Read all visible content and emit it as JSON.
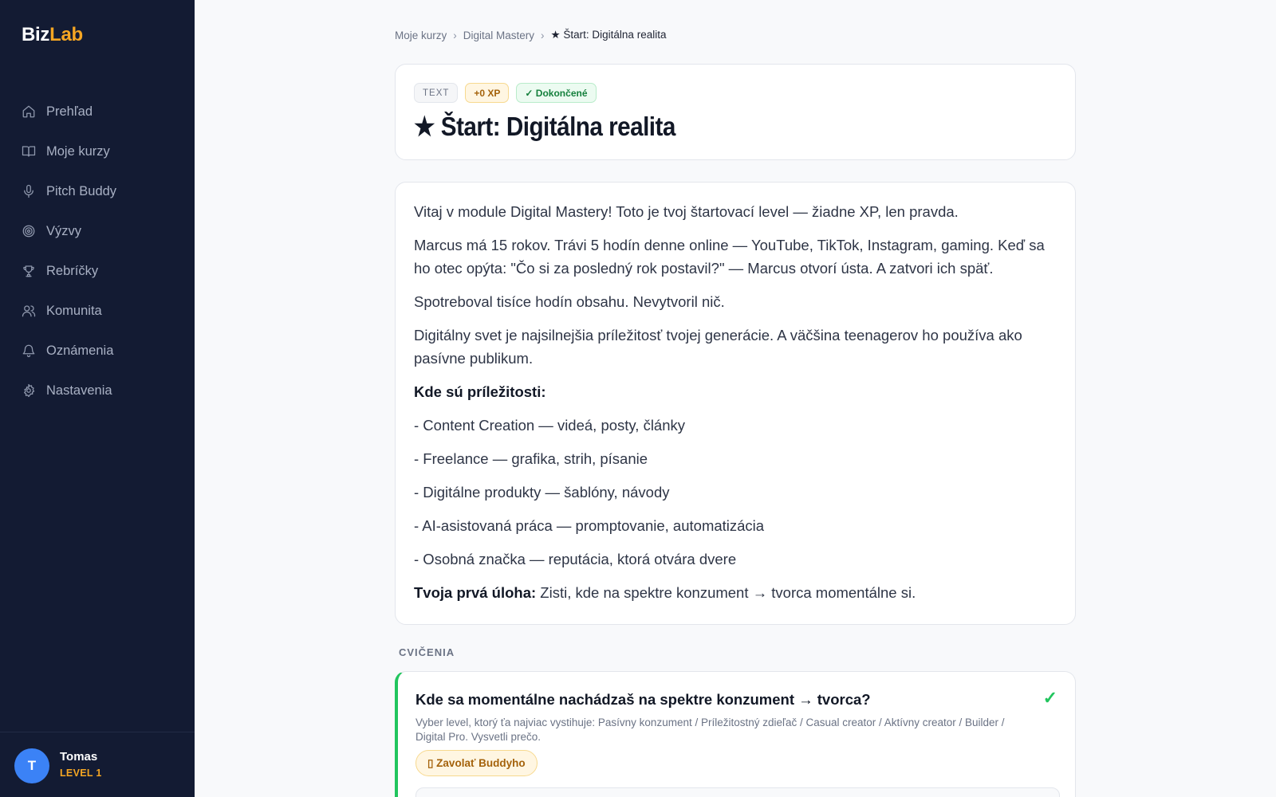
{
  "app": {
    "logo_part1": "Biz",
    "logo_part2": "Lab"
  },
  "sidebar": {
    "items": [
      {
        "label": "Prehľad",
        "icon": "home-icon"
      },
      {
        "label": "Moje kurzy",
        "icon": "book-icon"
      },
      {
        "label": "Pitch Buddy",
        "icon": "microphone-icon"
      },
      {
        "label": "Výzvy",
        "icon": "target-icon"
      },
      {
        "label": "Rebríčky",
        "icon": "trophy-icon"
      },
      {
        "label": "Komunita",
        "icon": "users-icon"
      },
      {
        "label": "Oznámenia",
        "icon": "bell-icon"
      },
      {
        "label": "Nastavenia",
        "icon": "gear-icon"
      }
    ],
    "user": {
      "initial": "T",
      "name": "Tomas",
      "level": "LEVEL 1"
    }
  },
  "breadcrumb": {
    "items": [
      "Moje kurzy",
      "Digital Mastery"
    ],
    "current": "★ Štart: Digitálna realita",
    "separator": "›"
  },
  "lesson": {
    "badges": {
      "type": "TEXT",
      "xp": "+0 XP",
      "status": "✓ Dokončené"
    },
    "title": "★ Štart: Digitálna realita",
    "paragraphs": [
      "Vitaj v module Digital Mastery! Toto je tvoj štartovací level — žiadne XP, len pravda.",
      "Marcus má 15 rokov. Trávi 5 hodín denne online — YouTube, TikTok, Instagram, gaming. Keď sa ho otec opýta: \"Čo si za posledný rok postavil?\" — Marcus otvorí ústa. A zatvori ich späť.",
      "Spotreboval tisíce hodín obsahu. Nevytvoril nič.",
      "Digitálny svet je najsilnejšia príležitosť tvojej generácie. A väčšina teenagerov ho používa ako pasívne publikum."
    ],
    "opportunities_heading": "Kde sú príležitosti:",
    "opportunities": [
      "- Content Creation — videá, posty, články",
      "- Freelance — grafika, strih, písanie",
      "- Digitálne produkty — šablóny, návody",
      "- AI-asistovaná práca — promptovanie, automatizácia",
      "- Osobná značka — reputácia, ktorá otvára dvere"
    ],
    "task_label": "Tvoja prvá úloha:",
    "task_text": " Zisti, kde na spektre konzument → tvorca momentálne si."
  },
  "exercises": {
    "section_label": "CVIČENIA",
    "items": [
      {
        "title": "Kde sa momentálne nachádzaš na spektre konzument → tvorca?",
        "description": "Vyber level, ktorý ťa najviac vystihuje: Pasívny konzument / Príležitostný zdieľač / Casual creator / Aktívny creator / Builder / Digital Pro. Vysvetli prečo.",
        "buddy_button": "▯ Zavolať Buddyho",
        "status_icon": "✓"
      }
    ]
  },
  "colors": {
    "sidebar_bg": "#131b33",
    "accent": "#f5a623",
    "success": "#22c55e",
    "avatar": "#3b82f6"
  }
}
